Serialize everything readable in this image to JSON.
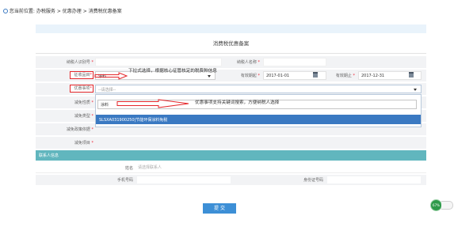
{
  "breadcrumb": {
    "prefix": "您当前位置:",
    "items": [
      "办税服务",
      "优惠办理",
      "消费税优惠备案"
    ],
    "sep": ">"
  },
  "form": {
    "title": "消费税优惠备案",
    "taxpayer_id_label": "纳税人识别号",
    "taxpayer_name_label": "纳税人名称",
    "levy_item_label": "征收品目",
    "levy_item_value": "涂料",
    "valid_from_label": "有效期起",
    "valid_from_value": "2017-01-01",
    "valid_to_label": "有效期止",
    "valid_to_value": "2017-12-31",
    "preference_label": "优惠事项",
    "preference_placeholder": "--请选择--",
    "reduction_nature_label": "减免性质",
    "reduction_type_label": "减免类型",
    "reduction_policy_label": "减免政策依据",
    "reduction_project_label": "减免项目",
    "search_value": "涂料",
    "option_selected": "SLSXA031900250|节能环保涂料免税",
    "required_mark": "*"
  },
  "contact": {
    "section_title": "联系人信息",
    "name_label": "姓名",
    "name_placeholder": "请选择联系人",
    "phone_label": "手机号码",
    "id_label": "身份证号码"
  },
  "submit_label": "提 交",
  "annotations": {
    "dropdown_note": "下拉式选择，根据核心征管核定的税费种信息",
    "search_note": "优惠事项支持关键词搜索，方便纳税人选择"
  },
  "widget": {
    "percent": "67%"
  },
  "colors": {
    "header_band": "#e9f3fb",
    "section_teal": "#61b6be",
    "dropdown_highlight": "#3a79c2",
    "submit_blue": "#3d8fd6",
    "annotation_red": "#e4262a"
  }
}
